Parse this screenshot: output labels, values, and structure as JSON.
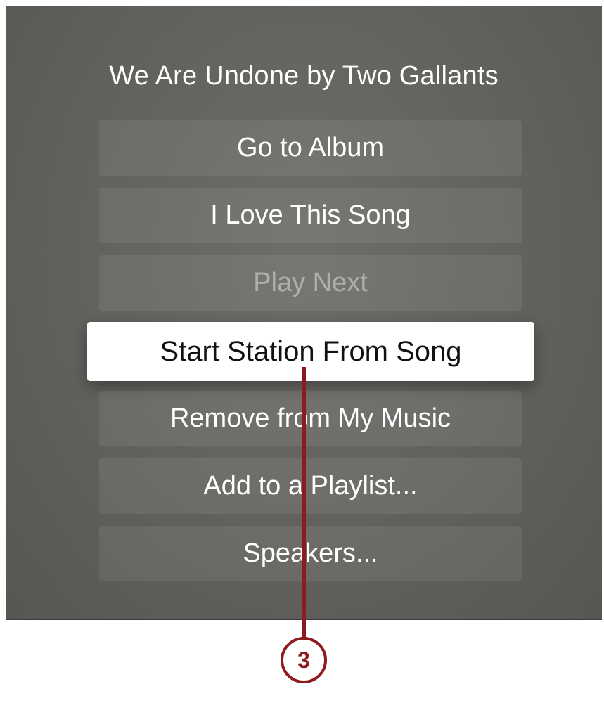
{
  "dialog": {
    "title": "We Are Undone by Two Gallants",
    "menu": [
      {
        "label": "Go to Album",
        "state": "normal"
      },
      {
        "label": "I Love This Song",
        "state": "normal"
      },
      {
        "label": "Play Next",
        "state": "disabled"
      },
      {
        "label": "Start Station From Song",
        "state": "selected"
      },
      {
        "label": "Remove from My Music",
        "state": "normal"
      },
      {
        "label": "Add to a Playlist...",
        "state": "normal"
      },
      {
        "label": "Speakers...",
        "state": "normal"
      }
    ]
  },
  "callout": {
    "number": "3",
    "color": "#8e1a1f"
  },
  "colors": {
    "background": "#65635f",
    "selected_bg": "#ffffff",
    "accent": "#8e1a1f"
  }
}
